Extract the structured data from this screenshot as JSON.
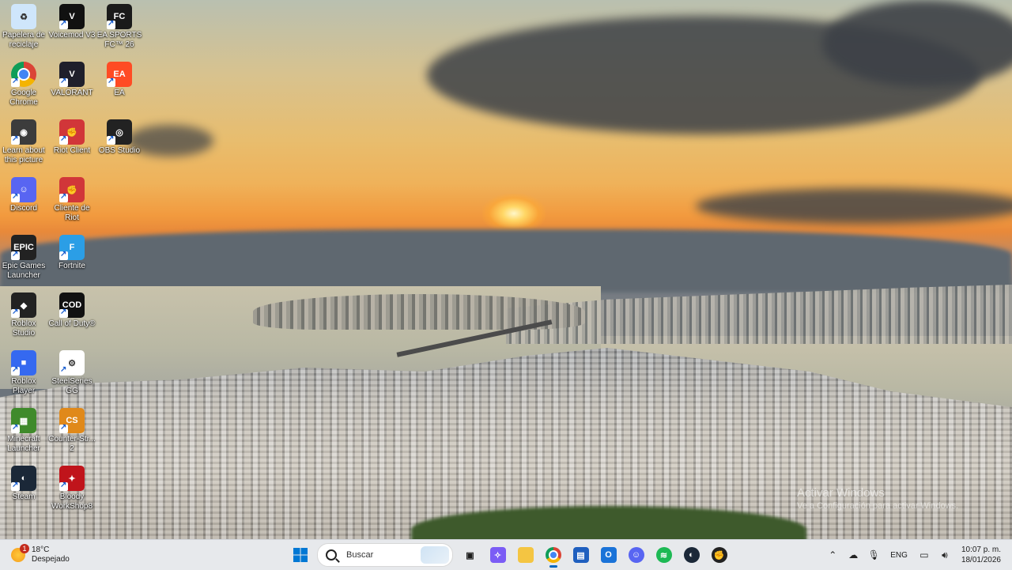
{
  "desktop": {
    "icons": [
      {
        "label": "Papelera de reciclaje",
        "icon": "recycle-bin-icon",
        "color": "#cfe6fb"
      },
      {
        "label": "Voicemod V3",
        "icon": "voicemod-icon",
        "color": "#111111"
      },
      {
        "label": "EA SPORTS FC™ 26",
        "icon": "ea-fc-icon",
        "color": "#1a1a1a"
      },
      {
        "label": "Google Chrome",
        "icon": "chrome-icon",
        "color": "#ffffff"
      },
      {
        "label": "VALORANT",
        "icon": "valorant-icon",
        "color": "#1f1f2b"
      },
      {
        "label": "EA",
        "icon": "ea-icon",
        "color": "#ff4b24"
      },
      {
        "label": "Learn about this picture",
        "icon": "camera-icon",
        "color": "#3c3c3c"
      },
      {
        "label": "Riot Client",
        "icon": "riot-fist-icon",
        "color": "#d13639"
      },
      {
        "label": "OBS Studio",
        "icon": "obs-icon",
        "color": "#222222"
      },
      {
        "label": "Discord",
        "icon": "discord-icon",
        "color": "#5865f2"
      },
      {
        "label": "Cliente de Riot",
        "icon": "riot-fist-icon",
        "color": "#d13639"
      },
      {
        "label": "Epic Games Launcher",
        "icon": "epic-games-icon",
        "color": "#222222"
      },
      {
        "label": "Fortnite",
        "icon": "fortnite-icon",
        "color": "#2b9ee6"
      },
      {
        "label": "Roblox Studio",
        "icon": "roblox-studio-icon",
        "color": "#222222"
      },
      {
        "label": "Call of Duty®",
        "icon": "call-of-duty-icon",
        "color": "#111111"
      },
      {
        "label": "Roblox Player",
        "icon": "roblox-player-icon",
        "color": "#3569f0"
      },
      {
        "label": "SteelSeries GG",
        "icon": "steelseries-icon",
        "color": "#ffffff"
      },
      {
        "label": "Minecraft Launcher",
        "icon": "minecraft-icon",
        "color": "#3f8a2b"
      },
      {
        "label": "Counter-Str... 2",
        "icon": "counter-strike-icon",
        "color": "#e0891a"
      },
      {
        "label": "Steam",
        "icon": "steam-icon",
        "color": "#1b2838"
      },
      {
        "label": "Bloody WorkShop8",
        "icon": "bloody-icon",
        "color": "#c0141b"
      }
    ]
  },
  "watermark": {
    "title": "Activar Windows",
    "subtitle": "Ve a Configuración para activar Windows."
  },
  "taskbar": {
    "weather": {
      "temp": "18°C",
      "condition": "Despejado",
      "badge": "1"
    },
    "search_placeholder": "Buscar",
    "pinned": [
      {
        "name": "start-button",
        "icon": "windows-start-icon",
        "color": "#0078d4"
      },
      {
        "name": "file-explorer-taskview",
        "icon": "task-view-icon",
        "color": "#1b1b1b"
      },
      {
        "name": "copilot-button",
        "icon": "copilot-icon",
        "color": "#7b5cf5"
      },
      {
        "name": "file-explorer-button",
        "icon": "folder-icon",
        "color": "#f4c542"
      },
      {
        "name": "chrome-taskbar-button",
        "icon": "chrome-icon",
        "color": "#ffffff"
      },
      {
        "name": "store-button",
        "icon": "store-icon",
        "color": "#1f5fbf"
      },
      {
        "name": "outlook-button",
        "icon": "outlook-icon",
        "color": "#1a73d8"
      },
      {
        "name": "discord-taskbar-button",
        "icon": "discord-icon",
        "color": "#5865f2"
      },
      {
        "name": "spotify-button",
        "icon": "spotify-icon",
        "color": "#1db954"
      },
      {
        "name": "steam-taskbar-button",
        "icon": "steam-icon",
        "color": "#1b2838"
      },
      {
        "name": "riot-taskbar-button",
        "icon": "riot-fist-icon",
        "color": "#222222"
      }
    ],
    "tray": {
      "language": "ENG",
      "time": "10:07 p. m.",
      "date": "18/01/2026"
    }
  }
}
